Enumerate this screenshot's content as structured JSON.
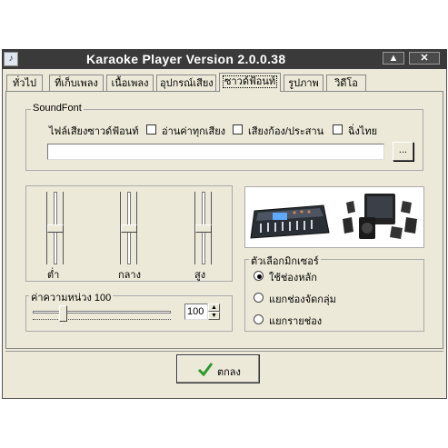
{
  "window": {
    "title": "Karaoke Player Version 2.0.0.38"
  },
  "titlebar_buttons": {
    "minimize": "▲",
    "close": "✕"
  },
  "tabs": [
    {
      "label": "ทั่วไป",
      "active": false
    },
    {
      "label": "ที่เก็บเพลง",
      "active": false
    },
    {
      "label": "เนื้อเพลง",
      "active": false
    },
    {
      "label": "อุปกรณ์เสียง",
      "active": false
    },
    {
      "label": "ซาวด์ฟ้อนท์",
      "active": true
    },
    {
      "label": "รูปภาพ",
      "active": false
    },
    {
      "label": "วิดีโอ",
      "active": false
    }
  ],
  "soundfont": {
    "group_label": "SoundFont",
    "file_label": "ไฟล์เสียงซาวด์ฟ้อนท์",
    "options": [
      {
        "label": "อ่านค่าทุกเสียง",
        "checked": false
      },
      {
        "label": "เสียงก้อง/ประสาน",
        "checked": false
      },
      {
        "label": "ฉิ่งไทย",
        "checked": false
      }
    ],
    "path_value": "",
    "browse_label": "..."
  },
  "equalizer": {
    "sliders": [
      {
        "label": "ต่ำ",
        "level": 0.5
      },
      {
        "label": "กลาง",
        "level": 0.5
      },
      {
        "label": "สูง",
        "level": 0.5
      }
    ]
  },
  "delay": {
    "label": "ค่าความหน่วง 100",
    "value": "100",
    "level": 0.2
  },
  "mixer": {
    "group_label": "ตัวเลือกมิกเซอร์",
    "options": [
      {
        "label": "ใช้ช่องหลัก",
        "selected": true
      },
      {
        "label": "แยกช่องจัดกลุ่ม",
        "selected": false
      },
      {
        "label": "แยกรายช่อง",
        "selected": false
      }
    ]
  },
  "footer": {
    "ok_label": "ตกลง",
    "ok_icon": "checkmark-icon"
  }
}
